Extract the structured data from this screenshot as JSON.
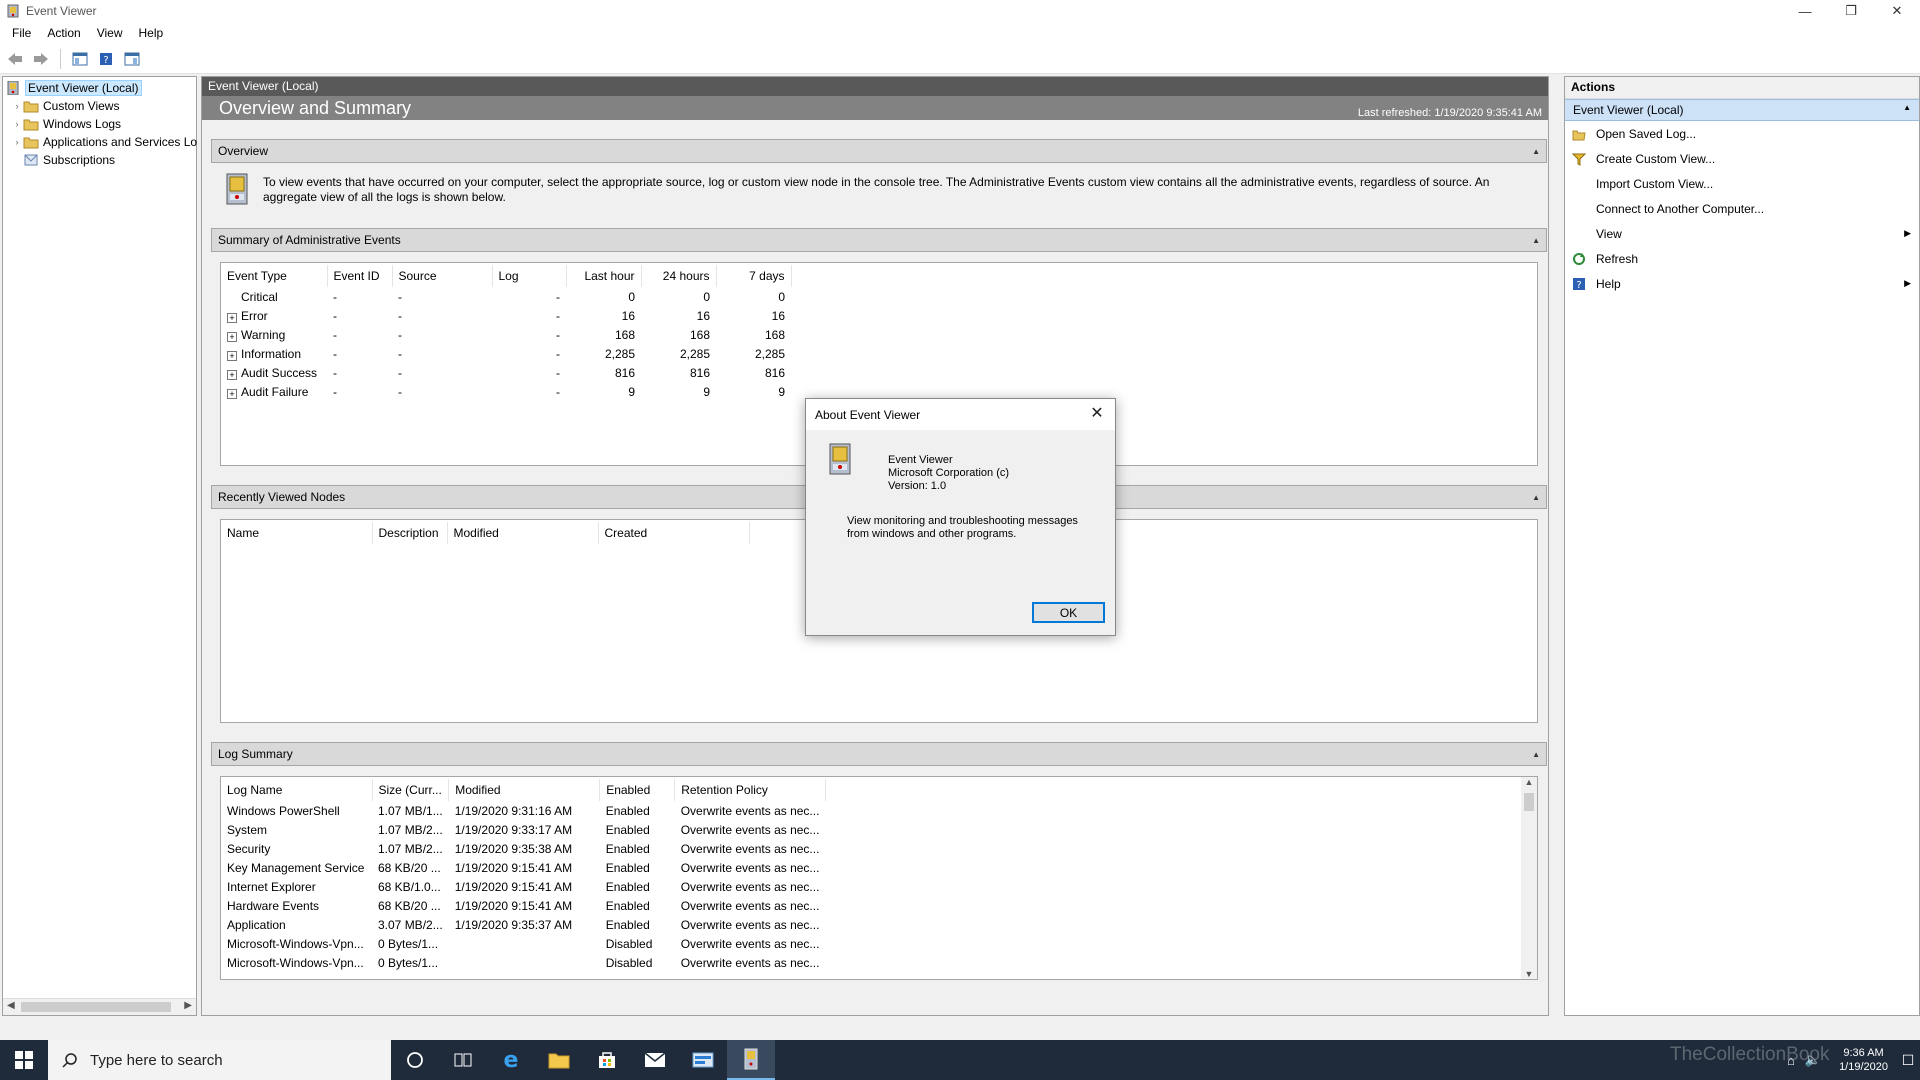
{
  "window": {
    "title": "Event Viewer",
    "minimize": "—",
    "restore": "❐",
    "close": "✕"
  },
  "menu": [
    "File",
    "Action",
    "View",
    "Help"
  ],
  "tree": {
    "items": [
      {
        "label": "Event Viewer (Local)",
        "selected": true,
        "expander": ""
      },
      {
        "label": "Custom Views",
        "expander": "›"
      },
      {
        "label": "Windows Logs",
        "expander": "›"
      },
      {
        "label": "Applications and Services Lo",
        "expander": "›"
      },
      {
        "label": "Subscriptions",
        "expander": ""
      }
    ]
  },
  "center": {
    "header": "Event Viewer (Local)",
    "banner_title": "Overview and Summary",
    "last_refreshed": "Last refreshed: 1/19/2020 9:35:41 AM",
    "overview": {
      "title": "Overview",
      "text": "To view events that have occurred on your computer, select the appropriate source, log or custom view node in the console tree. The Administrative Events custom view contains all the administrative events, regardless of source. An aggregate view of all the logs is shown below."
    },
    "summary": {
      "title": "Summary of Administrative Events",
      "columns": [
        "Event Type",
        "Event ID",
        "Source",
        "Log",
        "Last hour",
        "24 hours",
        "7 days"
      ],
      "rows": [
        {
          "type": "Critical",
          "id": "-",
          "source": "-",
          "log": "-",
          "hour": "0",
          "day": "0",
          "week": "0",
          "expand": false
        },
        {
          "type": "Error",
          "id": "-",
          "source": "-",
          "log": "-",
          "hour": "16",
          "day": "16",
          "week": "16",
          "expand": true
        },
        {
          "type": "Warning",
          "id": "-",
          "source": "-",
          "log": "-",
          "hour": "168",
          "day": "168",
          "week": "168",
          "expand": true
        },
        {
          "type": "Information",
          "id": "-",
          "source": "-",
          "log": "-",
          "hour": "2,285",
          "day": "2,285",
          "week": "2,285",
          "expand": true
        },
        {
          "type": "Audit Success",
          "id": "-",
          "source": "-",
          "log": "-",
          "hour": "816",
          "day": "816",
          "week": "816",
          "expand": true
        },
        {
          "type": "Audit Failure",
          "id": "-",
          "source": "-",
          "log": "-",
          "hour": "9",
          "day": "9",
          "week": "9",
          "expand": true
        }
      ]
    },
    "recent": {
      "title": "Recently Viewed Nodes",
      "columns": [
        "Name",
        "Description",
        "Modified",
        "Created"
      ]
    },
    "log_summary": {
      "title": "Log Summary",
      "columns": [
        "Log Name",
        "Size (Curr...",
        "Modified",
        "Enabled",
        "Retention Policy"
      ],
      "rows": [
        [
          "Windows PowerShell",
          "1.07 MB/1...",
          "1/19/2020 9:31:16 AM",
          "Enabled",
          "Overwrite events as nec..."
        ],
        [
          "System",
          "1.07 MB/2...",
          "1/19/2020 9:33:17 AM",
          "Enabled",
          "Overwrite events as nec..."
        ],
        [
          "Security",
          "1.07 MB/2...",
          "1/19/2020 9:35:38 AM",
          "Enabled",
          "Overwrite events as nec..."
        ],
        [
          "Key Management Service",
          "68 KB/20 ...",
          "1/19/2020 9:15:41 AM",
          "Enabled",
          "Overwrite events as nec..."
        ],
        [
          "Internet Explorer",
          "68 KB/1.0...",
          "1/19/2020 9:15:41 AM",
          "Enabled",
          "Overwrite events as nec..."
        ],
        [
          "Hardware Events",
          "68 KB/20 ...",
          "1/19/2020 9:15:41 AM",
          "Enabled",
          "Overwrite events as nec..."
        ],
        [
          "Application",
          "3.07 MB/2...",
          "1/19/2020 9:35:37 AM",
          "Enabled",
          "Overwrite events as nec..."
        ],
        [
          "Microsoft-Windows-Vpn...",
          "0 Bytes/1...",
          "",
          "Disabled",
          "Overwrite events as nec..."
        ],
        [
          "Microsoft-Windows-Vpn...",
          "0 Bytes/1...",
          "",
          "Disabled",
          "Overwrite events as nec..."
        ]
      ]
    }
  },
  "actions": {
    "title": "Actions",
    "group": "Event Viewer (Local)",
    "items": [
      {
        "label": "Open Saved Log...",
        "icon": "open-log-icon",
        "submenu": false
      },
      {
        "label": "Create Custom View...",
        "icon": "filter-icon",
        "submenu": false
      },
      {
        "label": "Import Custom View...",
        "icon": "",
        "submenu": false
      },
      {
        "label": "Connect to Another Computer...",
        "icon": "",
        "submenu": false
      },
      {
        "label": "View",
        "icon": "",
        "submenu": true
      },
      {
        "label": "Refresh",
        "icon": "refresh-icon",
        "submenu": false
      },
      {
        "label": "Help",
        "icon": "help-icon",
        "submenu": true
      }
    ]
  },
  "dialog": {
    "title": "About Event Viewer",
    "name": "Event Viewer",
    "company": "Microsoft Corporation (c)",
    "version": "Version: 1.0",
    "description": "View monitoring and troubleshooting messages from windows and other programs.",
    "ok": "OK"
  },
  "taskbar": {
    "search_placeholder": "Type here to search",
    "time": "9:36 AM",
    "date": "1/19/2020",
    "watermark": "TheCollectionBook"
  },
  "colors": {
    "accent": "#0078d7",
    "header_dark": "#595959",
    "banner": "#828282",
    "taskbar": "#1f2b3a"
  }
}
